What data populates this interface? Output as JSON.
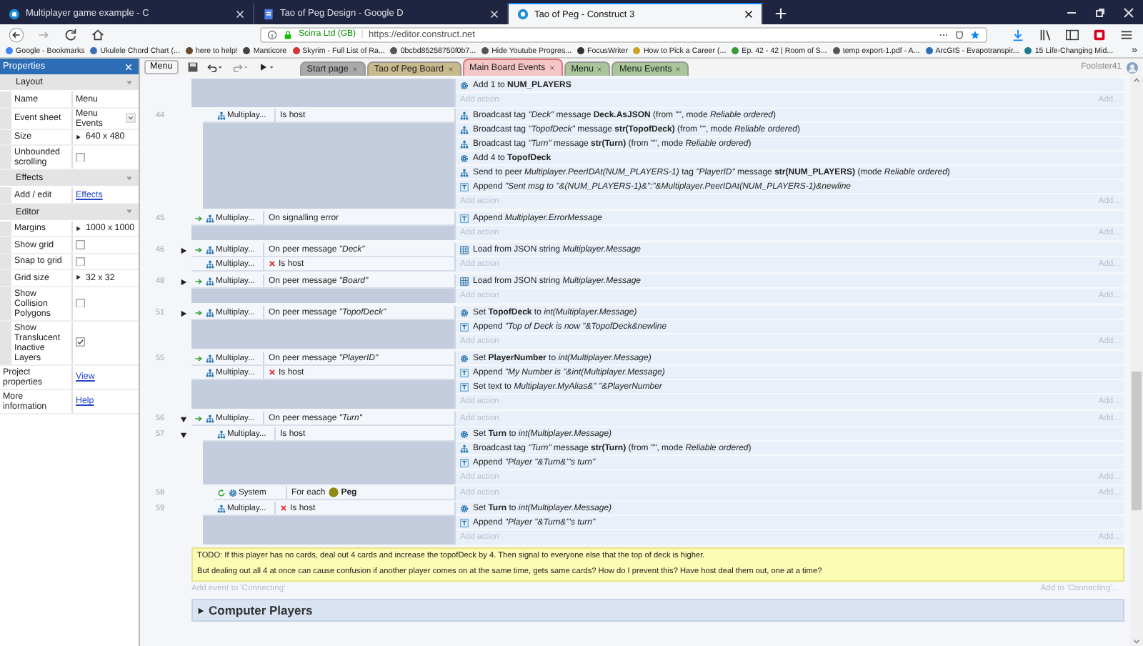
{
  "browser": {
    "tabs": [
      {
        "title": "Multiplayer game example - C",
        "kind": "construct",
        "selected": false
      },
      {
        "title": "Tao of Peg Design - Google D",
        "kind": "document",
        "selected": false
      },
      {
        "title": "Tao of Peg - Construct 3",
        "kind": "construct",
        "selected": true
      }
    ],
    "identity": "Scirra Ltd (GB)",
    "url": "https://editor.construct.net",
    "bookmarks": [
      {
        "title": "Google - Bookmarks",
        "color": "#4285f4"
      },
      {
        "title": "Ukulele Chord Chart (...",
        "color": "#3c6db4"
      },
      {
        "title": "here to help!",
        "color": "#6b4a2b"
      },
      {
        "title": "Manticore",
        "color": "#444444"
      },
      {
        "title": "Skyrim - Full List of Ra...",
        "color": "#d33333"
      },
      {
        "title": "0bcbd85258750f0b7...",
        "color": "#555555"
      },
      {
        "title": "Hide Youtube Progres...",
        "color": "#555555"
      },
      {
        "title": "FocusWriter",
        "color": "#333333"
      },
      {
        "title": "How to Pick a Career (...",
        "color": "#c9a227"
      },
      {
        "title": "Ep. 42 - 42 | Room of S...",
        "color": "#3a9a3a"
      },
      {
        "title": "temp export-1.pdf - A...",
        "color": "#555555"
      },
      {
        "title": "ArcGIS - Evapotranspir...",
        "color": "#2a6eb5"
      },
      {
        "title": "15 Life-Changing Mid...",
        "color": "#1f7a8c"
      }
    ],
    "bookmarks_overflow": "»"
  },
  "properties": {
    "title": "Properties",
    "sections": [
      {
        "title": "Layout",
        "rows": [
          {
            "label": "Name",
            "kind": "text",
            "value": "Menu"
          },
          {
            "label": "Event sheet",
            "kind": "dropdown",
            "value": "Menu Events"
          },
          {
            "label": "Size",
            "kind": "expandable",
            "value": "640 x 480"
          },
          {
            "label": "Unbounded scrolling",
            "kind": "checkbox",
            "checked": false
          }
        ]
      },
      {
        "title": "Effects",
        "rows": [
          {
            "label": "Add / edit",
            "kind": "link",
            "value": "Effects"
          }
        ]
      },
      {
        "title": "Editor",
        "rows": [
          {
            "label": "Margins",
            "kind": "expandable",
            "value": "1000 x 1000"
          },
          {
            "label": "Show grid",
            "kind": "checkbox",
            "checked": false
          },
          {
            "label": "Snap to grid",
            "kind": "checkbox",
            "checked": false
          },
          {
            "label": "Grid size",
            "kind": "expandable",
            "value": "32 x 32"
          },
          {
            "label": "Show Collision Polygons",
            "kind": "checkbox",
            "checked": false
          },
          {
            "label": "Show Translucent Inactive Layers",
            "kind": "checkbox",
            "checked": true
          }
        ]
      }
    ],
    "footer_rows": [
      {
        "label": "Project properties",
        "kind": "link",
        "value": "View"
      },
      {
        "label": "More information",
        "kind": "link",
        "value": "Help"
      }
    ]
  },
  "toolbar": {
    "layout_button": "Menu",
    "user": "Foolster41"
  },
  "editor_tabs": [
    {
      "label": "Start page",
      "color": "#a9a9a9",
      "selected": false
    },
    {
      "label": "Tao of Peg Board",
      "color": "#c8ba8c",
      "selected": false
    },
    {
      "label": "Main Board Events",
      "color": "#f4c6c6",
      "selected": true
    },
    {
      "label": "Menu",
      "color": "#a8c69a",
      "selected": false
    },
    {
      "label": "Menu Events",
      "color": "#a8c69a",
      "selected": false
    }
  ],
  "events": [
    {
      "actions": [
        {
          "kind": "system",
          "text": "Add 1 to **NUM_PLAYERS**"
        }
      ],
      "add_action": "Add action",
      "add_more": "Add...",
      "children": [
        {
          "line": "44",
          "conditions": [
            {
              "kind": "condition",
              "object": "Multiplay...",
              "text": "Is host",
              "inverted": false
            }
          ],
          "actions": [
            {
              "kind": "multiplayer",
              "text": "Broadcast tag *\"Deck\"* message **Deck.AsJSON** (from \"\", mode *Reliable ordered*)"
            },
            {
              "kind": "multiplayer",
              "text": "Broadcast tag *\"TopofDeck\"* message **str(TopofDeck)** (from \"\", mode *Reliable ordered*)"
            },
            {
              "kind": "multiplayer",
              "text": "Broadcast tag *\"Turn\"* message **str(Turn)** (from \"\", mode *Reliable ordered*)"
            },
            {
              "kind": "system",
              "text": "Add 4 to **TopofDeck**"
            },
            {
              "kind": "multiplayer",
              "text": "Send to peer *Multiplayer.PeerIDAt(NUM_PLAYERS-1)* tag *\"PlayerID\"* message **str(NUM_PLAYERS)** (mode *Reliable ordered*)"
            },
            {
              "kind": "text",
              "text": "Append *\"Sent msg to \"&(NUM_PLAYERS-1)&\":\"&Multiplayer.PeerIDAt(NUM_PLAYERS-1)&newline*"
            }
          ],
          "add_action": "Add action",
          "add_more": "Add..."
        }
      ]
    },
    {
      "line": "45",
      "conditions": [
        {
          "kind": "trigger",
          "object": "Multiplay...",
          "text": "On signalling error",
          "inverted": false
        }
      ],
      "actions": [
        {
          "kind": "text",
          "text": "Append *Multiplayer.ErrorMessage*"
        }
      ],
      "add_action": "Add action",
      "add_more": "Add..."
    },
    {
      "line": "46",
      "expanded": false,
      "conditions": [
        {
          "kind": "trigger",
          "object": "Multiplay...",
          "text": "On peer message *\"Deck\"*",
          "inverted": false
        },
        {
          "kind": "condition",
          "object": "Multiplay...",
          "text": "Is host",
          "inverted": true
        }
      ],
      "actions": [
        {
          "kind": "array",
          "text": "Load from JSON string *Multiplayer.Message*"
        }
      ],
      "add_action": "Add action",
      "add_more": "Add..."
    },
    {
      "line": "48",
      "expanded": false,
      "conditions": [
        {
          "kind": "trigger",
          "object": "Multiplay...",
          "text": "On peer message *\"Board\"*",
          "inverted": false
        }
      ],
      "actions": [
        {
          "kind": "array",
          "text": "Load from JSON string *Multiplayer.Message*"
        }
      ],
      "add_action": "Add action",
      "add_more": "Add..."
    },
    {
      "line": "51",
      "expanded": false,
      "conditions": [
        {
          "kind": "trigger",
          "object": "Multiplay...",
          "text": "On peer message *\"TopofDeck\"*",
          "inverted": false
        }
      ],
      "actions": [
        {
          "kind": "system",
          "text": "Set **TopofDeck** to *int(Multiplayer.Message)*"
        },
        {
          "kind": "text",
          "text": "Append *\"Top of Deck is now \"&TopofDeck&newline*"
        }
      ],
      "add_action": "Add action",
      "add_more": "Add..."
    },
    {
      "line": "55",
      "conditions": [
        {
          "kind": "trigger",
          "object": "Multiplay...",
          "text": "On peer message *\"PlayerID\"*",
          "inverted": false
        },
        {
          "kind": "condition",
          "object": "Multiplay...",
          "text": "Is host",
          "inverted": true
        }
      ],
      "actions": [
        {
          "kind": "system",
          "text": "Set **PlayerNumber** to *int(Multiplayer.Message)*"
        },
        {
          "kind": "text",
          "text": "Append *\"My Number is \"&int(Multiplayer.Message)*"
        },
        {
          "kind": "text",
          "text": "Set text to *Multiplayer.MyAlias&\" \"&PlayerNumber*"
        }
      ],
      "add_action": "Add action",
      "add_more": "Add..."
    },
    {
      "line": "56",
      "expanded": true,
      "conditions": [
        {
          "kind": "trigger",
          "object": "Multiplay...",
          "text": "On peer message *\"Turn\"*",
          "inverted": false
        }
      ],
      "add_action": "Add action",
      "add_more": "Add...",
      "children": [
        {
          "line": "57",
          "expanded": true,
          "conditions": [
            {
              "kind": "condition",
              "object": "Multiplay...",
              "text": "Is host",
              "inverted": false
            }
          ],
          "actions": [
            {
              "kind": "system",
              "text": "Set **Turn** to *int(Multiplayer.Message)*"
            },
            {
              "kind": "multiplayer",
              "text": "Broadcast tag *\"Turn\"* message **str(Turn)** (from \"\", mode *Reliable ordered*)"
            },
            {
              "kind": "text",
              "text": "Append *\"Player \"&Turn&\"'s turn\"*"
            }
          ],
          "add_action": "Add action",
          "add_more": "Add...",
          "children": [
            {
              "line": "58",
              "conditions": [
                {
                  "kind": "loop",
                  "object": "System",
                  "text": "For each",
                  "parameter": "Peg",
                  "inverted": false
                }
              ],
              "add_action": "Add action",
              "add_more": "Add..."
            }
          ]
        },
        {
          "line": "59",
          "conditions": [
            {
              "kind": "condition",
              "object": "Multiplay...",
              "text": "Is host",
              "inverted": true
            }
          ],
          "actions": [
            {
              "kind": "system",
              "text": "Set **Turn** to *int(Multiplayer.Message)*"
            },
            {
              "kind": "text",
              "text": "Append *\"Player \"&Turn&\"'s turn\"*"
            }
          ],
          "add_action": "Add action",
          "add_more": "Add..."
        }
      ]
    }
  ],
  "comment": [
    "TODO: If this player has no cards, deal out 4 cards and increase the topofDeck by 4. Then signal to everyone else that the top of deck is higher.",
    "But dealing out all 4 at once can cause confusion if another player comes on at the same time, gets same cards? How do I prevent this? Have host deal them out, one at a time?"
  ],
  "add_event": "Add event to 'Connecting'",
  "add_to_group": "Add to 'Connecting'...",
  "group": {
    "title": "Computer Players",
    "expanded": false
  }
}
